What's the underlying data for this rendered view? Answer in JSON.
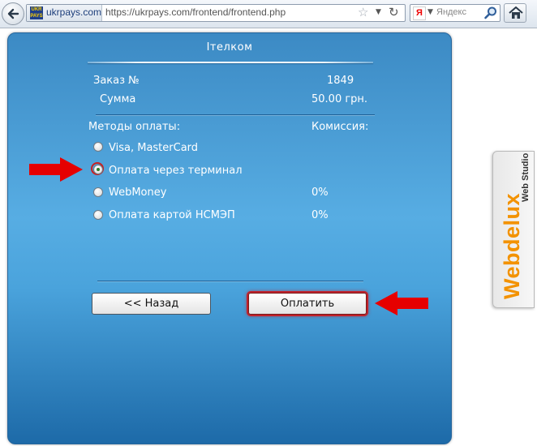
{
  "browser": {
    "site_identity": "ukrpays.com",
    "favicon_text": "UKR PAYS",
    "url": "https://ukrpays.com/frontend/frontend.php",
    "search_placeholder": "Яндекс",
    "search_engine_letter": "Я",
    "icons": [
      "back-icon",
      "bookmark-star-icon",
      "dropdown-icon",
      "reload-icon",
      "magnifier-icon",
      "home-icon"
    ]
  },
  "payment": {
    "title": "Ітелком",
    "order_label": "Заказ №",
    "order_value": "1849",
    "sum_label": "Сумма",
    "sum_value": "50.00 грн.",
    "methods_header": "Методы оплаты:",
    "commission_header": "Комиссия:",
    "methods": [
      {
        "label": "Visa, MasterCard",
        "commission": "",
        "selected": false
      },
      {
        "label": "Оплата через терминал",
        "commission": "",
        "selected": true
      },
      {
        "label": "WebMoney",
        "commission": "0%",
        "selected": false
      },
      {
        "label": "Оплата картой НСМЭП",
        "commission": "0%",
        "selected": false
      }
    ],
    "back_button": "<< Назад",
    "pay_button": "Оплатить"
  },
  "annotations": {
    "arrow_color": "#e60000",
    "highlight_color": "#c81f1f"
  },
  "side_tab": {
    "brand": "Webdelux",
    "subtitle": "Web Studio",
    "brand_color": "#f39200"
  },
  "colors": {
    "panel_blue": "#4aa3dc",
    "panel_dark": "#1d6aa8"
  }
}
